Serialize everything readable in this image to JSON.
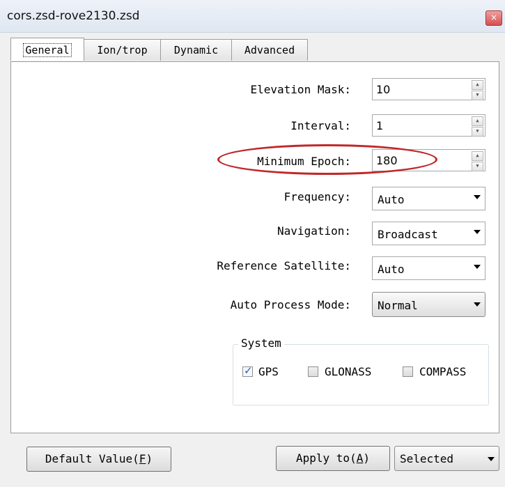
{
  "window": {
    "title": "cors.zsd-rove2130.zsd",
    "close_glyph": "×"
  },
  "tabs": [
    {
      "label": "General"
    },
    {
      "label": "Ion/trop"
    },
    {
      "label": "Dynamic"
    },
    {
      "label": "Advanced"
    }
  ],
  "form": {
    "elevation_mask": {
      "label": "Elevation Mask:",
      "value": "10"
    },
    "interval": {
      "label": "Interval:",
      "value": "1"
    },
    "minimum_epoch": {
      "label": "Minimum Epoch:",
      "value": "180"
    },
    "frequency": {
      "label": "Frequency:",
      "value": "Auto"
    },
    "navigation": {
      "label": "Navigation:",
      "value": "Broadcast"
    },
    "reference_satellite": {
      "label": "Reference Satellite:",
      "value": "Auto"
    },
    "auto_process_mode": {
      "label": "Auto Process Mode:",
      "value": "Normal"
    }
  },
  "system": {
    "title": "System",
    "options": [
      {
        "label": "GPS",
        "checked": true
      },
      {
        "label": "GLONASS",
        "checked": false
      },
      {
        "label": "COMPASS",
        "checked": false
      }
    ]
  },
  "footer": {
    "default_value_label": "Default Value",
    "default_value_mnemonic_open": "(",
    "default_value_key": "F",
    "default_value_mnemonic_close": ")",
    "apply_label": "Apply to",
    "apply_mnemonic_open": "(",
    "apply_key": "A",
    "apply_mnemonic_close": ")",
    "scope_value": "Selected"
  },
  "colors": {
    "highlight_ellipse": "#c0292a",
    "check_mark": "#2a5fb0"
  }
}
